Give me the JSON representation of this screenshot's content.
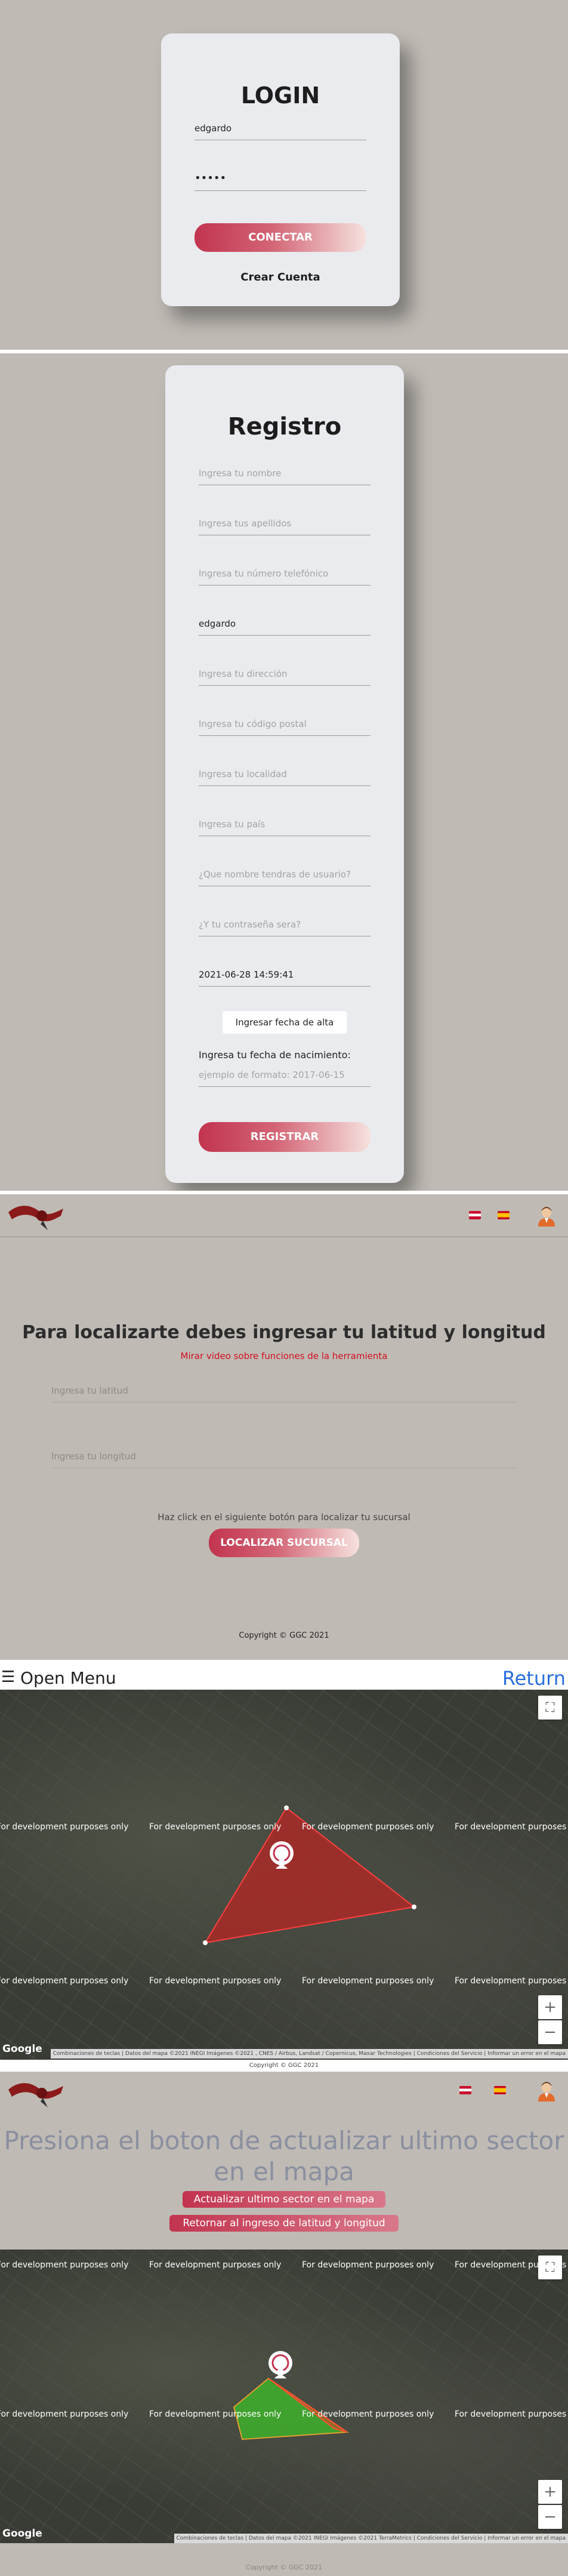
{
  "login": {
    "title": "LOGIN",
    "username": "edgardo",
    "password": "•••••",
    "connect_button": "CONECTAR",
    "create_account": "Crear Cuenta"
  },
  "registro": {
    "title": "Registro",
    "fields": {
      "nombre": "Ingresa tu nombre",
      "apellidos": "Ingresa tus apellidos",
      "telefono": "Ingresa tu número telefónico",
      "usuario_val": "edgardo",
      "direccion": "Ingresa tu dirección",
      "postal": "Ingresa tu código postal",
      "localidad": "Ingresa tu localidad",
      "pais": "Ingresa tu país",
      "nombre_usuario": "¿Que nombre tendras de usuario?",
      "contrasena": "¿Y tu contraseña sera?",
      "fecha_val": "2021-06-28 14:59:41"
    },
    "fecha_alta_button": "Ingresar fecha de alta",
    "nacimiento_label": "Ingresa tu fecha de nacimiento:",
    "nacimiento_placeholder": "ejemplo de formato: 2017-06-15",
    "register_button": "REGISTRAR"
  },
  "locate": {
    "heading": "Para localizarte debes ingresar tu latitud y longitud",
    "video_link": "Mirar video sobre funciones de la herramienta",
    "lat_placeholder": "Ingresa tu latitud",
    "lng_placeholder": "Ingresa tu longitud",
    "hint": "Haz click en el siguiente botón para localizar tu sucursal",
    "button": "LOCALIZAR SUCURSAL",
    "footer": "Copyright © GGC 2021"
  },
  "map1": {
    "open_menu": "Open Menu",
    "return": "Return",
    "dev_text": "For development purposes only",
    "google": "Google",
    "attribution": "Combinaciones de teclas | Datos del mapa ©2021 INEGI Imágenes ©2021 , CNES / Airbus, Landsat / Copernicus, Maxar Technologies | Condiciones del Servicio | Informar un error en el mapa",
    "footer": "Copyright © GGC 2021",
    "fullscreen_icon": "⛶",
    "zoom_in": "+",
    "zoom_out": "−"
  },
  "sector": {
    "heading": "Presiona el boton de actualizar ultimo sector en el mapa",
    "update_button": "Actualizar ultimo sector en el mapa",
    "return_button": "Retornar al ingreso de latitud y longitud",
    "dev_text": "For development purposes only",
    "google": "Google",
    "attribution": "Combinaciones de teclas | Datos del mapa ©2021 INEGI Imágenes ©2021 TerraMetrics | Condiciones del Servicio | Informar un error en el mapa",
    "footer": "Copyright © GGC 2021"
  },
  "colors": {
    "accent": "#c2344f",
    "polygon_red": "#c0201f",
    "polygon_green": "#3fbf2a",
    "return_blue": "#2a6fdb"
  }
}
